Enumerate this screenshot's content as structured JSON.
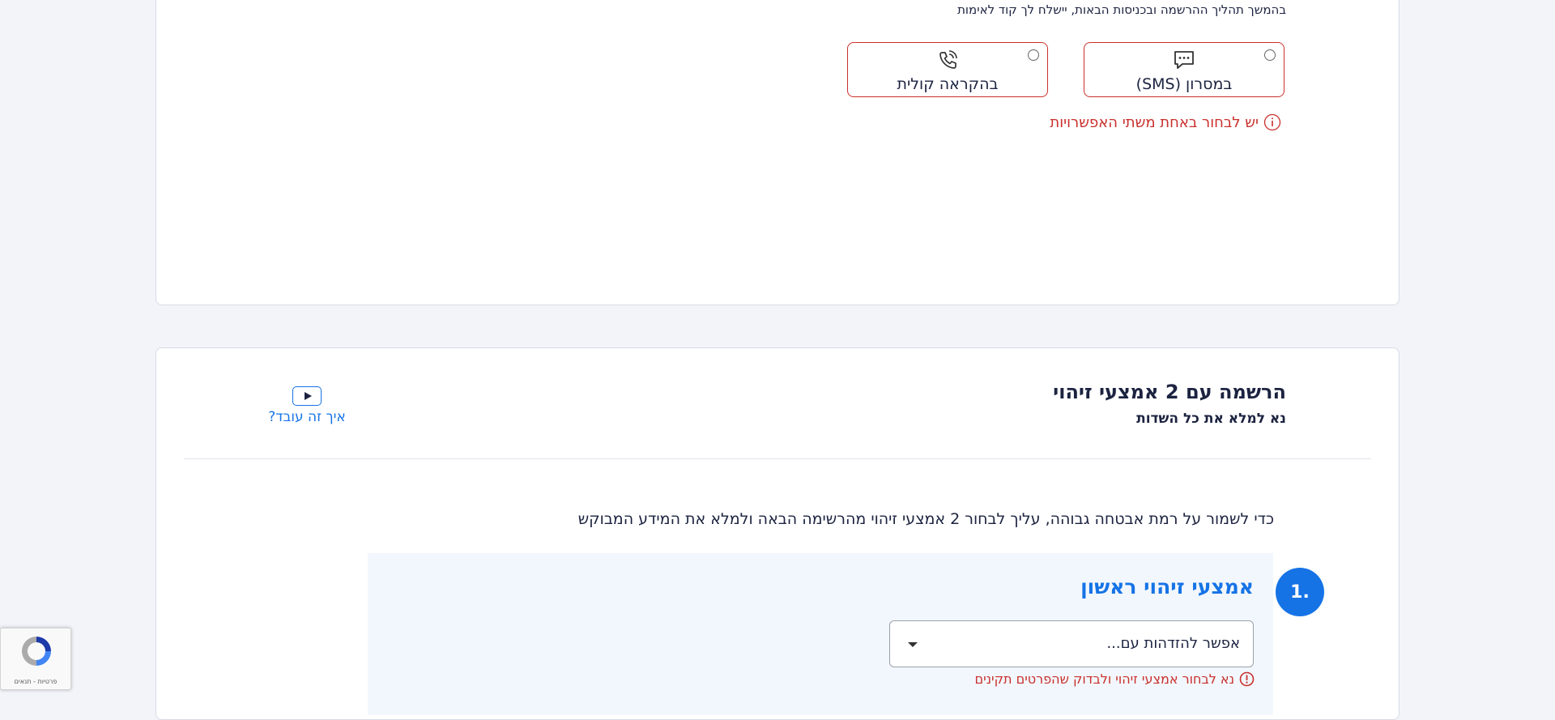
{
  "verification": {
    "note": "בהמשך תהליך ההרשמה ובכניסות הבאות, יישלח לך קוד לאימות",
    "options": [
      {
        "label": "במסרון (SMS)",
        "icon": "chat-icon"
      },
      {
        "label": "בהקראה קולית",
        "icon": "phone-call-icon"
      }
    ],
    "error": "יש לבחור באחת משתי האפשרויות"
  },
  "registration": {
    "title": "הרשמה עם 2 אמצעי זיהוי",
    "subtitle": "נא למלא את כל השדות",
    "how_it_works": "איך זה עובד?",
    "intro": "כדי לשמור על רמת אבטחה גבוהה, עליך לבחור 2 אמצעי זיהוי מהרשימה הבאה ולמלא את המידע המבוקש",
    "step": {
      "number": "1.",
      "title": "אמצעי זיהוי ראשון",
      "select_value": "אפשר להזדהות עם...",
      "error": "נא לבחור אמצעי זיהוי ולבדוק שהפרטים תקינים"
    }
  },
  "recaptcha": {
    "links": "פרטיות - תנאים"
  },
  "colors": {
    "error": "#c9302c",
    "accent": "#1673e6",
    "text": "#1c2340",
    "background": "#f3f4f9"
  }
}
